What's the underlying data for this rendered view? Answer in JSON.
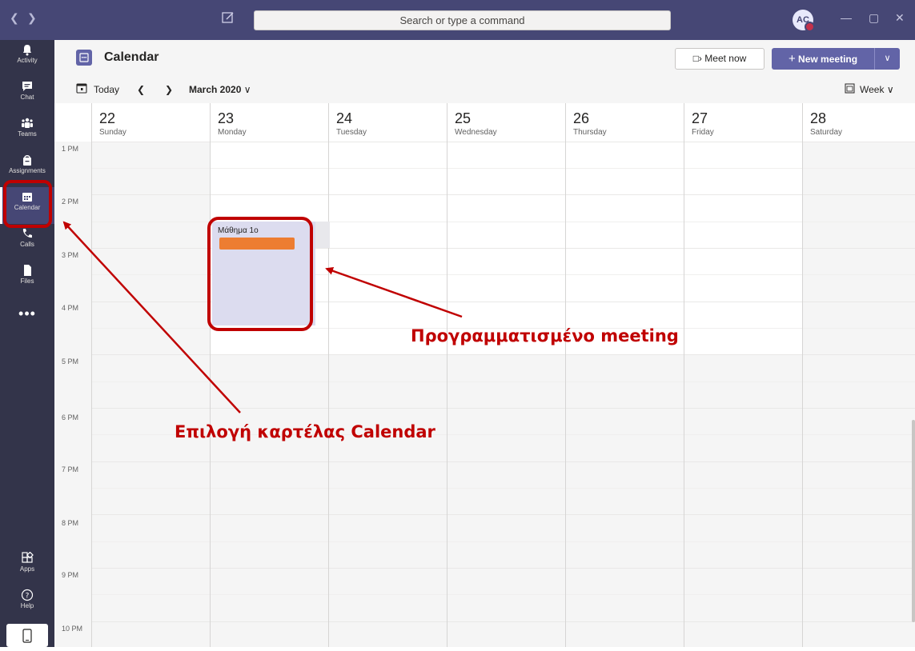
{
  "titlebar": {
    "search_placeholder": "Search or type a command",
    "avatar_initials": "AC",
    "back_icon": "chevron-left-icon",
    "forward_icon": "chevron-right-icon"
  },
  "rail": {
    "items": [
      {
        "label": "Activity",
        "icon": "bell-icon"
      },
      {
        "label": "Chat",
        "icon": "chat-icon"
      },
      {
        "label": "Teams",
        "icon": "teams-icon"
      },
      {
        "label": "Assignments",
        "icon": "assignments-icon"
      },
      {
        "label": "Calendar",
        "icon": "calendar-icon",
        "active": true
      },
      {
        "label": "Calls",
        "icon": "phone-icon"
      },
      {
        "label": "Files",
        "icon": "file-icon"
      }
    ],
    "more": "•••",
    "apps_label": "Apps",
    "help_label": "Help"
  },
  "header": {
    "title": "Calendar",
    "meet_now": "Meet now",
    "new_meeting": "New meeting"
  },
  "toolbar": {
    "today": "Today",
    "month": "March 2020",
    "view": "Week"
  },
  "days": [
    {
      "num": "22",
      "name": "Sunday"
    },
    {
      "num": "23",
      "name": "Monday"
    },
    {
      "num": "24",
      "name": "Tuesday"
    },
    {
      "num": "25",
      "name": "Wednesday"
    },
    {
      "num": "26",
      "name": "Thursday"
    },
    {
      "num": "27",
      "name": "Friday"
    },
    {
      "num": "28",
      "name": "Saturday"
    }
  ],
  "times": [
    "1 PM",
    "2 PM",
    "3 PM",
    "4 PM",
    "5 PM",
    "6 PM",
    "7 PM",
    "8 PM",
    "9 PM",
    "10 PM"
  ],
  "event": {
    "title": "Μάθημα 1ο"
  },
  "annotations": {
    "meeting": "Προγραμματισμένο meeting",
    "calendar_tab": "Επιλογή καρτέλας Calendar"
  },
  "colors": {
    "titlebar": "#464775",
    "rail": "#33344a",
    "accent": "#6264a7",
    "annotation": "#c00000",
    "event_bar": "#ed7d31"
  }
}
